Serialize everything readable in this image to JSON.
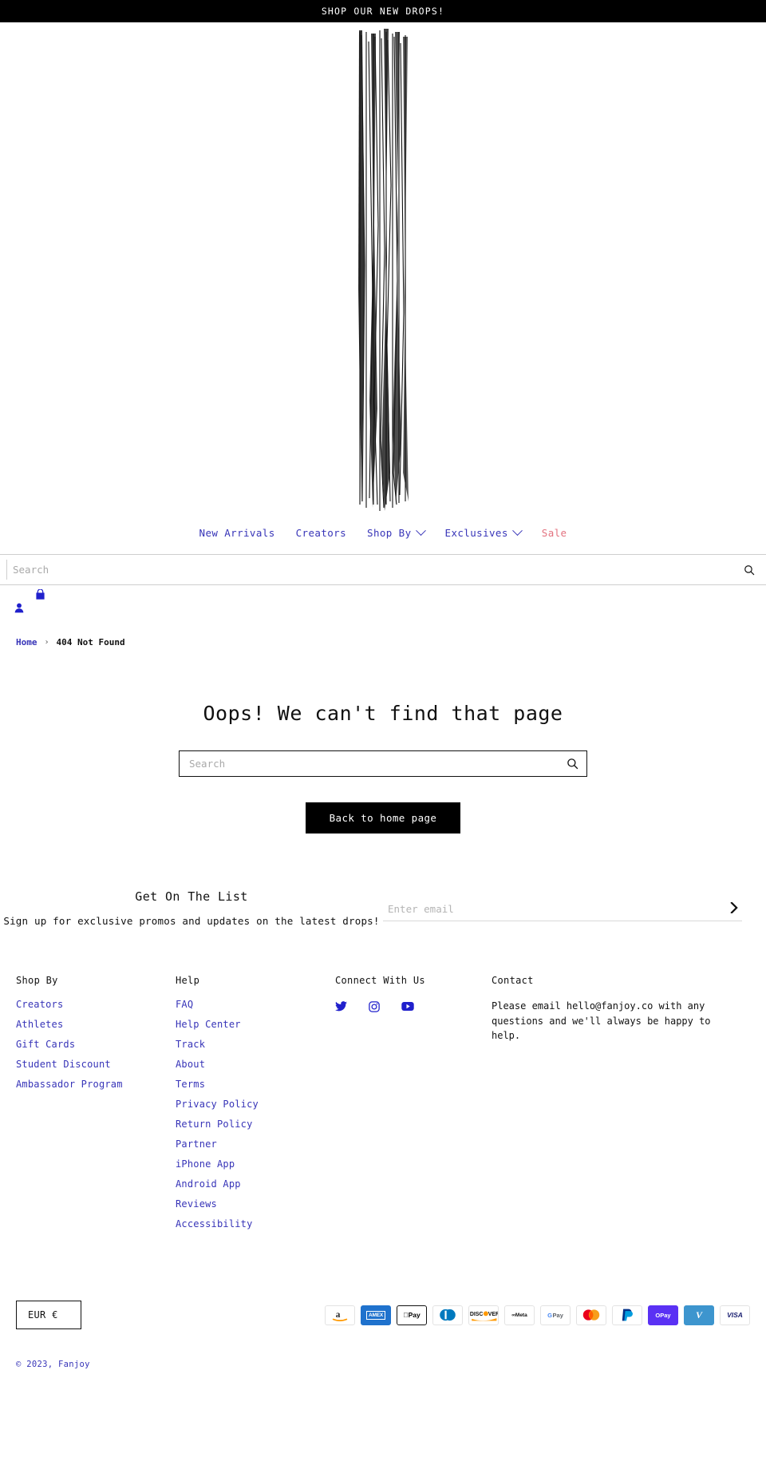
{
  "announcement": {
    "text": "SHOP OUR NEW DROPS!"
  },
  "brand": {
    "name": "FANJOY",
    "logo_alt": "fanjoy-logo"
  },
  "colors": {
    "link_blue": "#3734b8",
    "sale_pink": "#e3727f",
    "black": "#000000",
    "white": "#ffffff"
  },
  "nav": {
    "items": [
      {
        "label": "New Arrivals",
        "has_dropdown": false,
        "style": "default"
      },
      {
        "label": "Creators",
        "has_dropdown": false,
        "style": "default"
      },
      {
        "label": "Shop By",
        "has_dropdown": true,
        "style": "default"
      },
      {
        "label": "Exclusives",
        "has_dropdown": true,
        "style": "default"
      },
      {
        "label": "Sale",
        "has_dropdown": false,
        "style": "sale"
      }
    ]
  },
  "header_search": {
    "placeholder": "Search",
    "value": "",
    "icon": "search-icon"
  },
  "header_icons": {
    "bag": "shopping-bag-icon",
    "account": "user-account-icon"
  },
  "breadcrumb": {
    "home": "Home",
    "separator": "›",
    "current": "404 Not Found"
  },
  "main": {
    "heading": "Oops! We can't find that page",
    "search": {
      "placeholder": "Search",
      "value": "",
      "icon": "search-icon"
    },
    "home_button": "Back to home page"
  },
  "newsletter": {
    "title": "Get On The List",
    "subtitle": "Sign up for exclusive promos and updates on the latest drops!",
    "email_placeholder": "Enter email",
    "email_value": "",
    "submit_icon": "chevron-right-icon"
  },
  "footer": {
    "columns": [
      {
        "title": "Shop By",
        "links": [
          "Creators",
          "Athletes",
          "Gift Cards",
          "Student Discount",
          "Ambassador Program"
        ]
      },
      {
        "title": "Help",
        "links": [
          "FAQ",
          "Help Center",
          "Track",
          "About",
          "Terms",
          "Privacy Policy",
          "Return Policy",
          "Partner",
          "iPhone App",
          "Android App",
          "Reviews",
          "Accessibility"
        ]
      }
    ],
    "connect": {
      "title": "Connect With Us",
      "socials": [
        "twitter-icon",
        "instagram-icon",
        "youtube-icon"
      ]
    },
    "contact": {
      "title": "Contact",
      "text": "Please email hello@fanjoy.co with any questions and we'll always be happy to help."
    }
  },
  "bottom": {
    "currency": "EUR €",
    "payments": [
      "Amazon",
      "AMEX",
      "Apple Pay",
      "Diners Club",
      "Discover",
      "Meta Pay",
      "Google Pay",
      "Mastercard",
      "PayPal",
      "Shop Pay",
      "Venmo",
      "VISA"
    ],
    "copyright": "© 2023, Fanjoy"
  }
}
